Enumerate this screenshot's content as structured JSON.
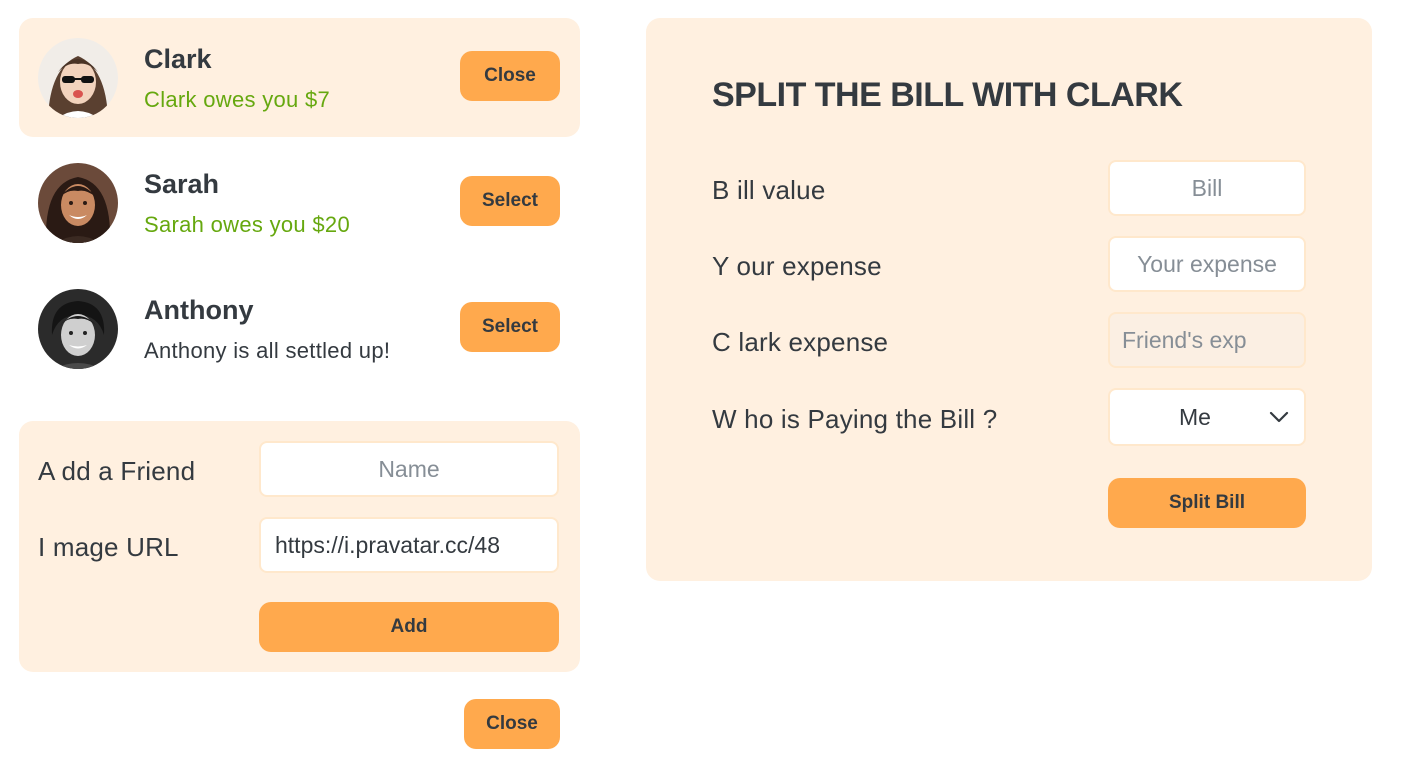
{
  "friends": [
    {
      "name": "Clark",
      "status": "Clark owes you $7",
      "status_kind": "positive",
      "button": "Close",
      "selected": true
    },
    {
      "name": "Sarah",
      "status": "Sarah owes you $20",
      "status_kind": "positive",
      "button": "Select",
      "selected": false
    },
    {
      "name": "Anthony",
      "status": "Anthony is all settled up!",
      "status_kind": "even",
      "button": "Select",
      "selected": false
    }
  ],
  "add_friend": {
    "name_label": "A dd a Friend",
    "name_placeholder": "Name",
    "image_label": "I mage URL",
    "image_value": "https://i.pravatar.cc/48",
    "add_button": "Add"
  },
  "close_button": "Close",
  "split": {
    "title": "SPLIT THE BILL WITH CLARK",
    "bill_label": "B ill value",
    "bill_placeholder": "Bill",
    "your_label": "Y our expense",
    "your_placeholder": "Your expense",
    "friend_label": "C lark expense",
    "friend_placeholder": "Friend's exp",
    "payer_label": "W ho is Paying the Bill ?",
    "payer_value": "Me",
    "submit_button": "Split Bill"
  },
  "colors": {
    "accent": "#ffa94d",
    "panel": "#fff0e0",
    "positive": "#66a80f",
    "text": "#343a40"
  },
  "icons": [
    "chevron-down-icon"
  ]
}
